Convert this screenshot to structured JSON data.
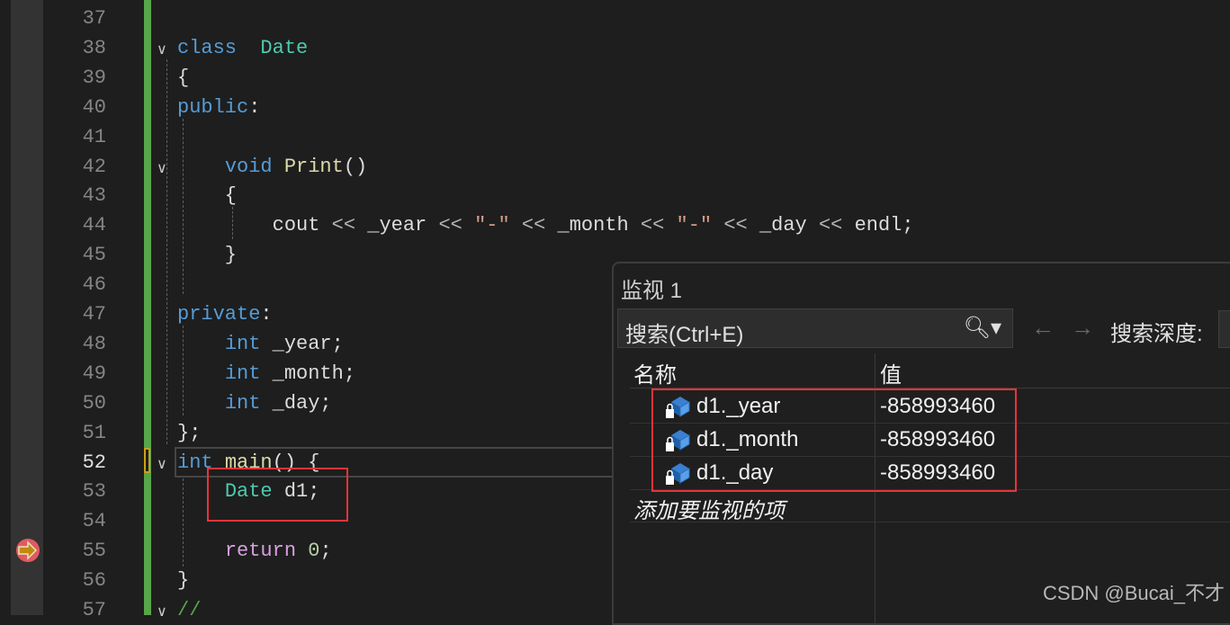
{
  "editor": {
    "current_line": 52,
    "breakpoint_line": 55,
    "lines": [
      {
        "n": "37",
        "tokens": []
      },
      {
        "n": "38",
        "tokens": [
          [
            "kw",
            "class"
          ],
          [
            "",
            "  "
          ],
          [
            "ty",
            "Date"
          ]
        ]
      },
      {
        "n": "39",
        "tokens": [
          [
            "",
            "{"
          ]
        ]
      },
      {
        "n": "40",
        "tokens": [
          [
            "kw",
            "public"
          ],
          [
            "",
            ":"
          ]
        ]
      },
      {
        "n": "41",
        "tokens": []
      },
      {
        "n": "42",
        "tokens": [
          [
            "",
            "    "
          ],
          [
            "kw",
            "void"
          ],
          [
            "",
            " "
          ],
          [
            "fn",
            "Print"
          ],
          [
            "",
            "()"
          ]
        ]
      },
      {
        "n": "43",
        "tokens": [
          [
            "",
            "    {"
          ]
        ]
      },
      {
        "n": "44",
        "tokens": [
          [
            "",
            "        cout "
          ],
          [
            "op",
            "<<"
          ],
          [
            "",
            " _year "
          ],
          [
            "op",
            "<<"
          ],
          [
            "",
            " "
          ],
          [
            "str",
            "\"-\""
          ],
          [
            "",
            " "
          ],
          [
            "op",
            "<<"
          ],
          [
            "",
            " _month "
          ],
          [
            "op",
            "<<"
          ],
          [
            "",
            " "
          ],
          [
            "str",
            "\"-\""
          ],
          [
            "",
            " "
          ],
          [
            "op",
            "<<"
          ],
          [
            "",
            " _day "
          ],
          [
            "op",
            "<<"
          ],
          [
            "",
            " endl;"
          ]
        ]
      },
      {
        "n": "45",
        "tokens": [
          [
            "",
            "    }"
          ]
        ]
      },
      {
        "n": "46",
        "tokens": []
      },
      {
        "n": "47",
        "tokens": [
          [
            "kw",
            "private"
          ],
          [
            "",
            ":"
          ]
        ]
      },
      {
        "n": "48",
        "tokens": [
          [
            "",
            "    "
          ],
          [
            "kw",
            "int"
          ],
          [
            "",
            " _year;"
          ]
        ]
      },
      {
        "n": "49",
        "tokens": [
          [
            "",
            "    "
          ],
          [
            "kw",
            "int"
          ],
          [
            "",
            " _month;"
          ]
        ]
      },
      {
        "n": "50",
        "tokens": [
          [
            "",
            "    "
          ],
          [
            "kw",
            "int"
          ],
          [
            "",
            " _day;"
          ]
        ]
      },
      {
        "n": "51",
        "tokens": [
          [
            "",
            "};"
          ]
        ]
      },
      {
        "n": "52",
        "tokens": [
          [
            "kw",
            "int"
          ],
          [
            "",
            " "
          ],
          [
            "fn",
            "main"
          ],
          [
            "",
            "() {"
          ]
        ]
      },
      {
        "n": "53",
        "tokens": [
          [
            "",
            "    "
          ],
          [
            "ty",
            "Date"
          ],
          [
            "",
            " d1;"
          ]
        ]
      },
      {
        "n": "54",
        "tokens": []
      },
      {
        "n": "55",
        "tokens": [
          [
            "",
            "    "
          ],
          [
            "ctl",
            "return"
          ],
          [
            "",
            " "
          ],
          [
            "num",
            "0"
          ],
          [
            "",
            ";"
          ]
        ]
      },
      {
        "n": "56",
        "tokens": [
          [
            "",
            "}"
          ]
        ]
      },
      {
        "n": "57",
        "tokens": [
          [
            "cm",
            "//"
          ]
        ]
      }
    ]
  },
  "watch": {
    "title": "监视 1",
    "search_placeholder": "搜索(Ctrl+E)",
    "search_icon": "magnifier-icon",
    "back_arrow": "←",
    "forward_arrow": "→",
    "search_depth_label": "搜索深度:",
    "columns": {
      "name": "名称",
      "value": "值"
    },
    "rows": [
      {
        "name": "d1._year",
        "value": "-858993460"
      },
      {
        "name": "d1._month",
        "value": "-858993460"
      },
      {
        "name": "d1._day",
        "value": "-858993460"
      }
    ],
    "add_item": "添加要监视的项"
  },
  "watermark": "CSDN @Bucai_不才",
  "colors": {
    "keyword": "#569cd6",
    "type": "#4ec9b0",
    "function": "#dcdcaa",
    "highlight": "#e8343a",
    "changebar": "#57a64a"
  }
}
